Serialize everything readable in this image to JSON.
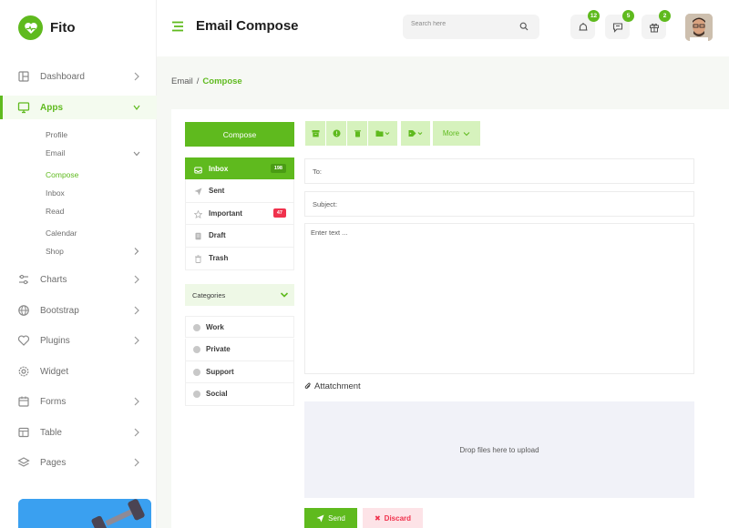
{
  "brand": {
    "name": "Fito",
    "accent": "#5fba1e"
  },
  "header": {
    "title": "Email Compose",
    "search_placeholder": "Search here",
    "notifications_count": "12",
    "messages_count": "5",
    "gifts_count": "2"
  },
  "sidebar": {
    "items": [
      {
        "label": "Dashboard",
        "icon": "dashboard-icon"
      },
      {
        "label": "Apps",
        "icon": "monitor-icon"
      },
      {
        "label": "Charts",
        "icon": "sliders-icon"
      },
      {
        "label": "Bootstrap",
        "icon": "globe-icon"
      },
      {
        "label": "Plugins",
        "icon": "heart-icon"
      },
      {
        "label": "Widget",
        "icon": "settings-icon"
      },
      {
        "label": "Forms",
        "icon": "calendar-icon"
      },
      {
        "label": "Table",
        "icon": "table-icon"
      },
      {
        "label": "Pages",
        "icon": "layers-icon"
      }
    ],
    "apps_sub": {
      "profile": "Profile",
      "email": "Email",
      "compose": "Compose",
      "inbox": "Inbox",
      "read": "Read",
      "calendar": "Calendar",
      "shop": "Shop"
    }
  },
  "breadcrumb": {
    "parent": "Email",
    "current": "Compose"
  },
  "mail": {
    "compose_label": "Compose",
    "folders": [
      {
        "label": "Inbox",
        "count": "198"
      },
      {
        "label": "Sent",
        "count": ""
      },
      {
        "label": "Important",
        "count": "47"
      },
      {
        "label": "Draft",
        "count": ""
      },
      {
        "label": "Trash",
        "count": ""
      }
    ],
    "categories_label": "Categories",
    "categories": [
      "Work",
      "Private",
      "Support",
      "Social"
    ]
  },
  "toolbar": {
    "more_label": "More"
  },
  "compose": {
    "to_placeholder": "To:",
    "subject_placeholder": "Subject:",
    "body_placeholder": "Enter text ...",
    "attachment_label": "Attatchment",
    "dropzone_text": "Drop files here to upload",
    "send_label": "Send",
    "discard_label": "Discard"
  }
}
